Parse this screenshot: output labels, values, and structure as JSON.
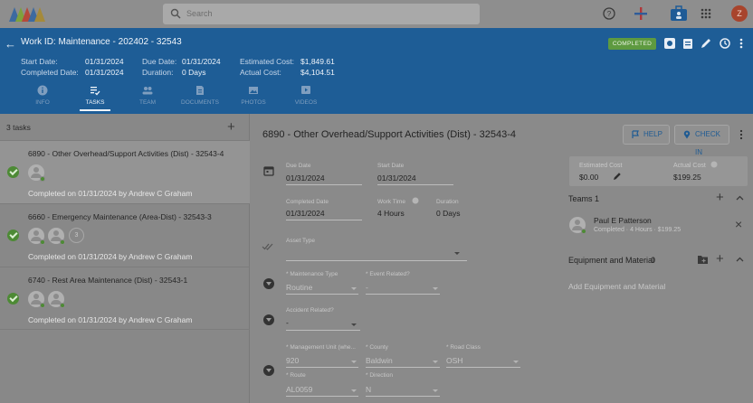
{
  "app": {
    "search_placeholder": "Search",
    "avatar_letter": "Z"
  },
  "header": {
    "title": "Work ID: Maintenance - 202402 - 32543",
    "status": "COMPLETED",
    "start_date_label": "Start Date:",
    "start_date": "01/31/2024",
    "completed_date_label": "Completed Date:",
    "completed_date": "01/31/2024",
    "due_date_label": "Due Date:",
    "due_date": "01/31/2024",
    "duration_label": "Duration:",
    "duration": "0 Days",
    "estimated_cost_label": "Estimated Cost:",
    "estimated_cost": "$1,849.61",
    "actual_cost_label": "Actual Cost:",
    "actual_cost": "$4,104.51",
    "tabs": [
      {
        "label": "INFO",
        "icon": "info-icon"
      },
      {
        "label": "TASKS",
        "icon": "tasks-icon"
      },
      {
        "label": "TEAM",
        "icon": "team-icon"
      },
      {
        "label": "DOCUMENTS",
        "icon": "document-icon"
      },
      {
        "label": "PHOTOS",
        "icon": "photo-icon"
      },
      {
        "label": "VIDEOS",
        "icon": "video-icon"
      }
    ]
  },
  "tasks": {
    "count_label": "3 tasks",
    "items": [
      {
        "title": "6890 - Other Overhead/Support Activities (Dist) - 32543-4",
        "completed": "Completed on 01/31/2024 by Andrew C Graham"
      },
      {
        "title": "6660 - Emergency Maintenance (Area-Dist) - 32543-3",
        "completed": "Completed on 01/31/2024 by Andrew C Graham",
        "extra_count": "3"
      },
      {
        "title": "6740 - Rest Area Maintenance (Dist) - 32543-1",
        "completed": "Completed on 01/31/2024 by Andrew C Graham"
      }
    ]
  },
  "detail": {
    "title": "6890 - Other Overhead/Support Activities (Dist) - 32543-4",
    "help_label": "HELP",
    "checkin_label": "CHECK IN",
    "due_date_label": "Due Date",
    "due_date": "01/31/2024",
    "start_date_label": "Start Date",
    "start_date": "01/31/2024",
    "completed_date_label": "Completed Date",
    "completed_date": "01/31/2024",
    "work_time_label": "Work Time",
    "work_time": "4 Hours",
    "duration_label": "Duration",
    "duration": "0 Days",
    "asset_type_label": "Asset Type",
    "maintenance_type_label": "* Maintenance Type",
    "maintenance_type": "Routine",
    "event_related_label": "* Event Related?",
    "event_related": "-",
    "accident_related_label": "Accident Related?",
    "accident_related": "-",
    "management_unit_label": "* Management Unit (whe...",
    "management_unit": "920",
    "county_label": "* County",
    "county": "Baldwin",
    "road_class_label": "* Road Class",
    "road_class": "OSH",
    "route_label": "* Route",
    "route": "AL0059",
    "direction_label": "* Direction",
    "direction": "N"
  },
  "side": {
    "estimated_cost_label": "Estimated Cost",
    "estimated_cost": "$0.00",
    "actual_cost_label": "Actual Cost",
    "actual_cost": "$199.25",
    "teams_label": "Teams",
    "teams_count": "1",
    "member_name": "Paul E Patterson",
    "member_sub": "Completed · 4 Hours · $199.25",
    "equipment_label": "Equipment and Material",
    "equipment_count": "0",
    "add_equipment": "Add Equipment and Material"
  }
}
